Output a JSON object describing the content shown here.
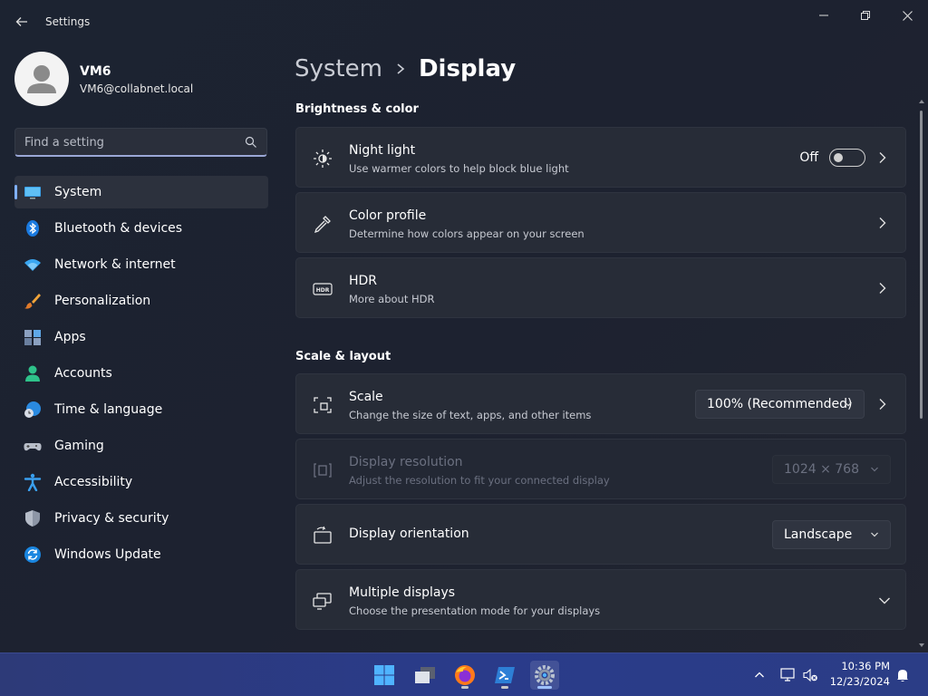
{
  "window": {
    "title": "Settings"
  },
  "profile": {
    "name": "VM6",
    "email": "VM6@collabnet.local"
  },
  "search": {
    "placeholder": "Find a setting",
    "value": ""
  },
  "sidebar": {
    "items": [
      {
        "label": "System",
        "icon": "monitor-icon",
        "active": true
      },
      {
        "label": "Bluetooth & devices",
        "icon": "bluetooth-icon"
      },
      {
        "label": "Network & internet",
        "icon": "wifi-icon"
      },
      {
        "label": "Personalization",
        "icon": "brush-icon"
      },
      {
        "label": "Apps",
        "icon": "apps-icon"
      },
      {
        "label": "Accounts",
        "icon": "person-icon"
      },
      {
        "label": "Time & language",
        "icon": "globe-clock-icon"
      },
      {
        "label": "Gaming",
        "icon": "gamepad-icon"
      },
      {
        "label": "Accessibility",
        "icon": "accessibility-icon"
      },
      {
        "label": "Privacy & security",
        "icon": "shield-icon"
      },
      {
        "label": "Windows Update",
        "icon": "update-icon"
      }
    ]
  },
  "main": {
    "breadcrumb": {
      "parent": "System",
      "separator": ">",
      "current": "Display"
    },
    "sections": [
      {
        "title": "Brightness & color",
        "cards": [
          {
            "title": "Night light",
            "subtitle": "Use warmer colors to help block blue light",
            "icon": "night-light-icon",
            "toggle_label": "Off",
            "toggle_on": false
          },
          {
            "title": "Color profile",
            "subtitle": "Determine how colors appear on your screen",
            "icon": "eyedropper-icon"
          },
          {
            "title": "HDR",
            "subtitle": "More about HDR",
            "icon": "hdr-icon",
            "icon_text": "HDR"
          }
        ]
      },
      {
        "title": "Scale & layout",
        "cards": [
          {
            "title": "Scale",
            "subtitle": "Change the size of text, apps, and other items",
            "icon": "scale-icon",
            "dropdown_value": "100% (Recommended)"
          },
          {
            "title": "Display resolution",
            "subtitle": "Adjust the resolution to fit your connected display",
            "icon": "resolution-icon",
            "dropdown_value": "1024 × 768",
            "disabled": true
          },
          {
            "title": "Display orientation",
            "subtitle": "",
            "icon": "orientation-icon",
            "dropdown_value": "Landscape"
          },
          {
            "title": "Multiple displays",
            "subtitle": "Choose the presentation mode for your displays",
            "icon": "multiple-displays-icon"
          }
        ]
      }
    ]
  },
  "taskbar": {
    "clock_time": "10:36 PM",
    "clock_date": "12/23/2024"
  },
  "colors": {
    "accent": "#7fb0ff",
    "background": "#1d2230",
    "card": "#272c37",
    "taskbar": "#2a3b8a"
  }
}
